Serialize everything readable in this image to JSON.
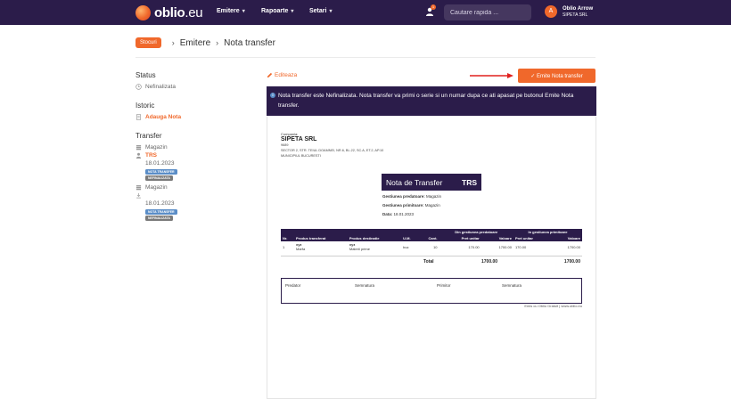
{
  "header": {
    "logo_brand": "oblio",
    "logo_tld": ".eu",
    "nav": [
      "Emitere",
      "Rapoarte",
      "Setari"
    ],
    "notification_count": "1",
    "search_placeholder": "Cautare rapida ...",
    "user": {
      "name": "Oblio Arrow",
      "company": "SIPETA SRL",
      "initial": "A"
    }
  },
  "breadcrumb": {
    "tag": "Stocuri",
    "items": [
      "Emitere",
      "Nota transfer"
    ]
  },
  "sidebar": {
    "status_title": "Status",
    "status_value": "Nefinalizata",
    "history_title": "Istoric",
    "history_action": "Adauga Nota",
    "transfer_title": "Transfer",
    "transfer": [
      {
        "location": "Magazin",
        "code": "TRS",
        "date": "18.01.2023",
        "tags": [
          "NOTA TRANSFER",
          "NEFINALIZATA"
        ]
      },
      {
        "location": "Magazin",
        "code": "",
        "date": "18.01.2023",
        "tags": [
          "NOTA TRANSFER",
          "NEFINALIZATA"
        ]
      }
    ]
  },
  "actions": {
    "edit_label": "Editeaza",
    "emit_label": "Emite Nota transfer"
  },
  "notice": "Nota transfer este Nefinalizata. Nota transfer va primi o serie si un numar dupa ce ati apasat pe butonul Emite Nota transfer.",
  "document": {
    "company_label": "Compania:",
    "company_name": "SIPETA SRL",
    "company_code": "9689",
    "company_address": "SECTOR 2, STR. TEIUL DOAMNEI, NR.6, BL.22, SC.A, ET.2, AP.10",
    "company_city": "MUNICIPIUL BUCURESTI",
    "title": "Nota de Transfer",
    "series": "TRS",
    "meta": [
      {
        "label": "Gestiunea predatoare:",
        "value": "Magazin"
      },
      {
        "label": "Gestiunea primitoare:",
        "value": "Magazin"
      },
      {
        "label": "Data:",
        "value": "18.01.2023"
      }
    ],
    "table": {
      "group_headers": [
        "Din gestiunea predatoare",
        "In gestiunea primitoare"
      ],
      "columns": [
        "Nr.",
        "Produs transferat",
        "Produs destinatie",
        "U.M.",
        "Cant.",
        "Pret unitar",
        "Valoare",
        "Pret unitar",
        "Valoare"
      ],
      "rows": [
        {
          "nr": "1",
          "product": "xyz",
          "product_type": "Marfa",
          "dest": "xyz",
          "dest_type": "Materii prime",
          "um": "buc",
          "qty": "10",
          "price1": "170.00",
          "value1": "1700.00",
          "price2": "170.00",
          "value2": "1700.00"
        }
      ],
      "total_label": "Total",
      "total1": "1700.00",
      "total2": "1700.00"
    },
    "signatures": [
      "Predator",
      "Semnatura",
      "Primitor",
      "Semnatura"
    ],
    "footer": "Emis cu Oblio Gratuit | www.oblio.eu"
  }
}
